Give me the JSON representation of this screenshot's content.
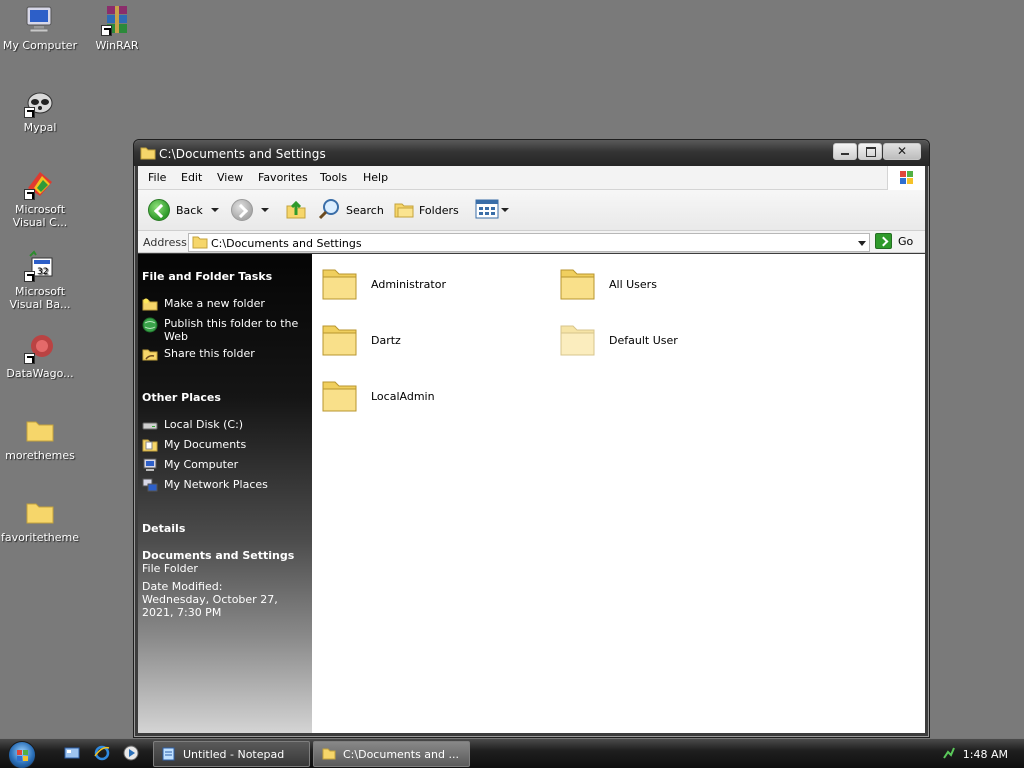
{
  "desktop": {
    "icons": [
      {
        "label": "My Computer"
      },
      {
        "label": "WinRAR"
      },
      {
        "label": "Mypal"
      },
      {
        "label": "Microsoft Visual C..."
      },
      {
        "label": "Microsoft Visual Ba..."
      },
      {
        "label": "DataWago..."
      },
      {
        "label": "morethemes"
      },
      {
        "label": "favoritetheme"
      }
    ]
  },
  "window": {
    "title": "C:\\Documents and Settings",
    "menu": [
      "File",
      "Edit",
      "View",
      "Favorites",
      "Tools",
      "Help"
    ],
    "toolbar": {
      "back_label": "Back",
      "search_label": "Search",
      "folders_label": "Folders"
    },
    "address": {
      "label": "Address",
      "value": "C:\\Documents and Settings",
      "go_label": "Go"
    },
    "taskpane": {
      "file_tasks": {
        "heading": "File and Folder Tasks",
        "items": [
          "Make a new folder",
          "Publish this folder to the Web",
          "Share this folder"
        ]
      },
      "other_places": {
        "heading": "Other Places",
        "items": [
          "Local Disk (C:)",
          "My Documents",
          "My Computer",
          "My Network Places"
        ]
      },
      "details": {
        "heading": "Details",
        "name": "Documents and Settings",
        "type": "File Folder",
        "modified": "Date Modified: Wednesday, October 27, 2021, 7:30 PM"
      }
    },
    "folders": [
      "Administrator",
      "All Users",
      "Dartz",
      "Default User",
      "LocalAdmin"
    ]
  },
  "taskbar": {
    "buttons": [
      "Untitled - Notepad",
      "C:\\Documents and ..."
    ],
    "clock": "1:48 AM"
  }
}
